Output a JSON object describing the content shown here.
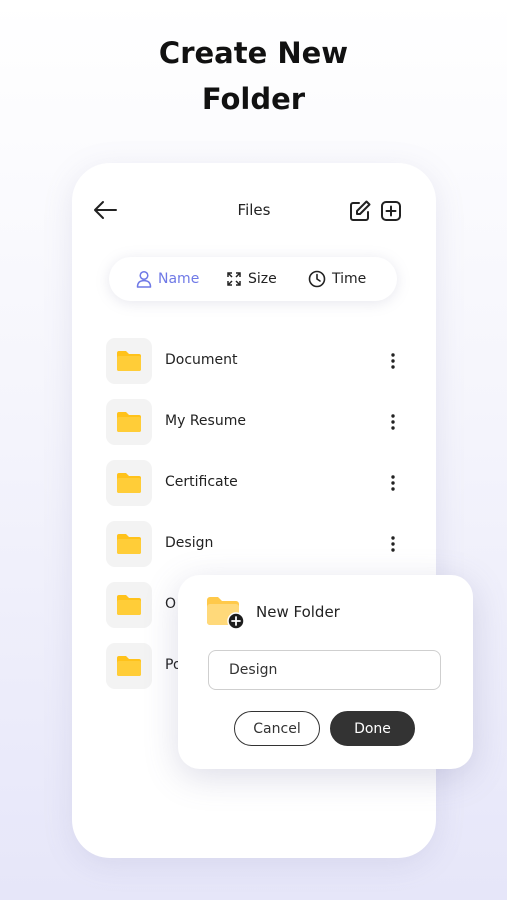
{
  "headline": {
    "line1": "Create New",
    "line2": "Folder"
  },
  "topbar": {
    "title": "Files"
  },
  "sort": {
    "options": [
      {
        "label": "Name",
        "icon": "user-icon",
        "active": true
      },
      {
        "label": "Size",
        "icon": "expand-icon",
        "active": false
      },
      {
        "label": "Time",
        "icon": "clock-icon",
        "active": false
      }
    ]
  },
  "files": [
    {
      "name": "Document"
    },
    {
      "name": "My Resume"
    },
    {
      "name": "Certificate"
    },
    {
      "name": "Design"
    },
    {
      "name": "O"
    },
    {
      "name": "Po"
    }
  ],
  "dialog": {
    "title": "New Folder",
    "input_value": "Design",
    "cancel_label": "Cancel",
    "done_label": "Done"
  },
  "colors": {
    "accent": "#6f79e6",
    "folder": "#ffc21a",
    "folder_light": "#ffd97a",
    "dark_button": "#333333"
  }
}
